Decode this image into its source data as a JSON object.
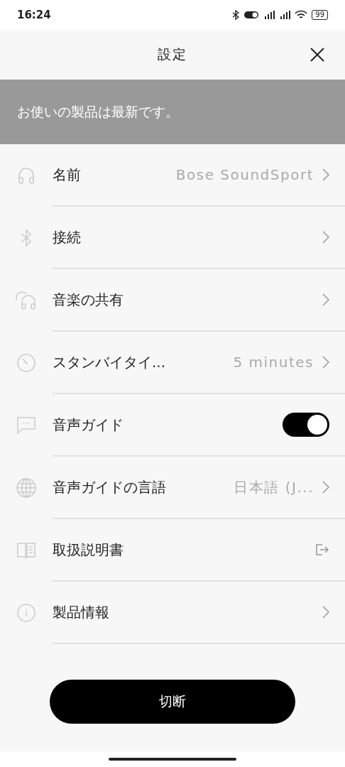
{
  "status_bar": {
    "time": "16:24",
    "battery": "99"
  },
  "header": {
    "title": "設定"
  },
  "banner": {
    "message": "お使いの製品は最新です。"
  },
  "settings": [
    {
      "kind": "link",
      "label": "名前",
      "value": "Bose SoundSport"
    },
    {
      "kind": "link",
      "label": "接続"
    },
    {
      "kind": "link",
      "label": "音楽の共有"
    },
    {
      "kind": "link",
      "label": "スタンバイタイ...",
      "value": "5 minutes"
    },
    {
      "kind": "toggle",
      "label": "音声ガイド",
      "on": true
    },
    {
      "kind": "link",
      "label": "音声ガイドの言語",
      "value": "日本語 (J..."
    },
    {
      "kind": "external",
      "label": "取扱説明書"
    },
    {
      "kind": "link",
      "label": "製品情報"
    }
  ],
  "disconnect_button": {
    "label": "切断"
  }
}
